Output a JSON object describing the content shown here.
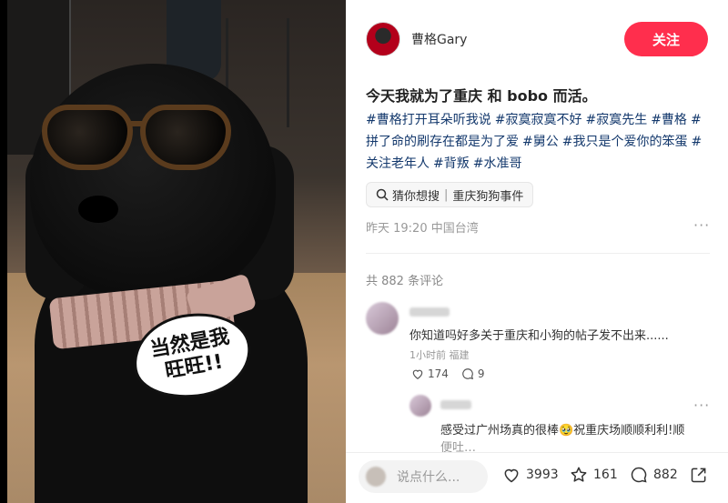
{
  "photo": {
    "sticker_line1": "当然是我",
    "sticker_line2": "旺旺!!"
  },
  "author": {
    "name": "曹格Gary",
    "follow_label": "关注"
  },
  "post": {
    "title": "今天我就为了重庆 和 bobo 而活。",
    "tags": [
      "#曹格打开耳朵听我说",
      "#寂寞寂寞不好",
      "#寂寞先生",
      "#曹格",
      "#拼了命的刷存在都是为了爱",
      "#舅公",
      "#我只是个爱你的笨蛋",
      "#关注老年人",
      "#背叛",
      "#水准哥"
    ],
    "guess_label": "猜你想搜",
    "guess_query": "重庆狗狗事件",
    "meta": "昨天 19:20 中国台湾",
    "more": "···"
  },
  "comments": {
    "count_label": "共 882 条评论",
    "items": [
      {
        "text": "你知道吗好多关于重庆和小狗的帖子发不出来......",
        "time": "1小时前 福建",
        "likes": "174",
        "replies": "9",
        "more": "···"
      },
      {
        "text": "感受过广州场真的很棒🥹祝重庆场顺顺利利!顺",
        "text2": "便吐…",
        "more": "···"
      }
    ]
  },
  "bottom_bar": {
    "placeholder": "说点什么...",
    "likes": "3993",
    "stars": "161",
    "comments": "882"
  },
  "colors": {
    "accent": "#ff2e4d",
    "tag": "#13386c"
  }
}
